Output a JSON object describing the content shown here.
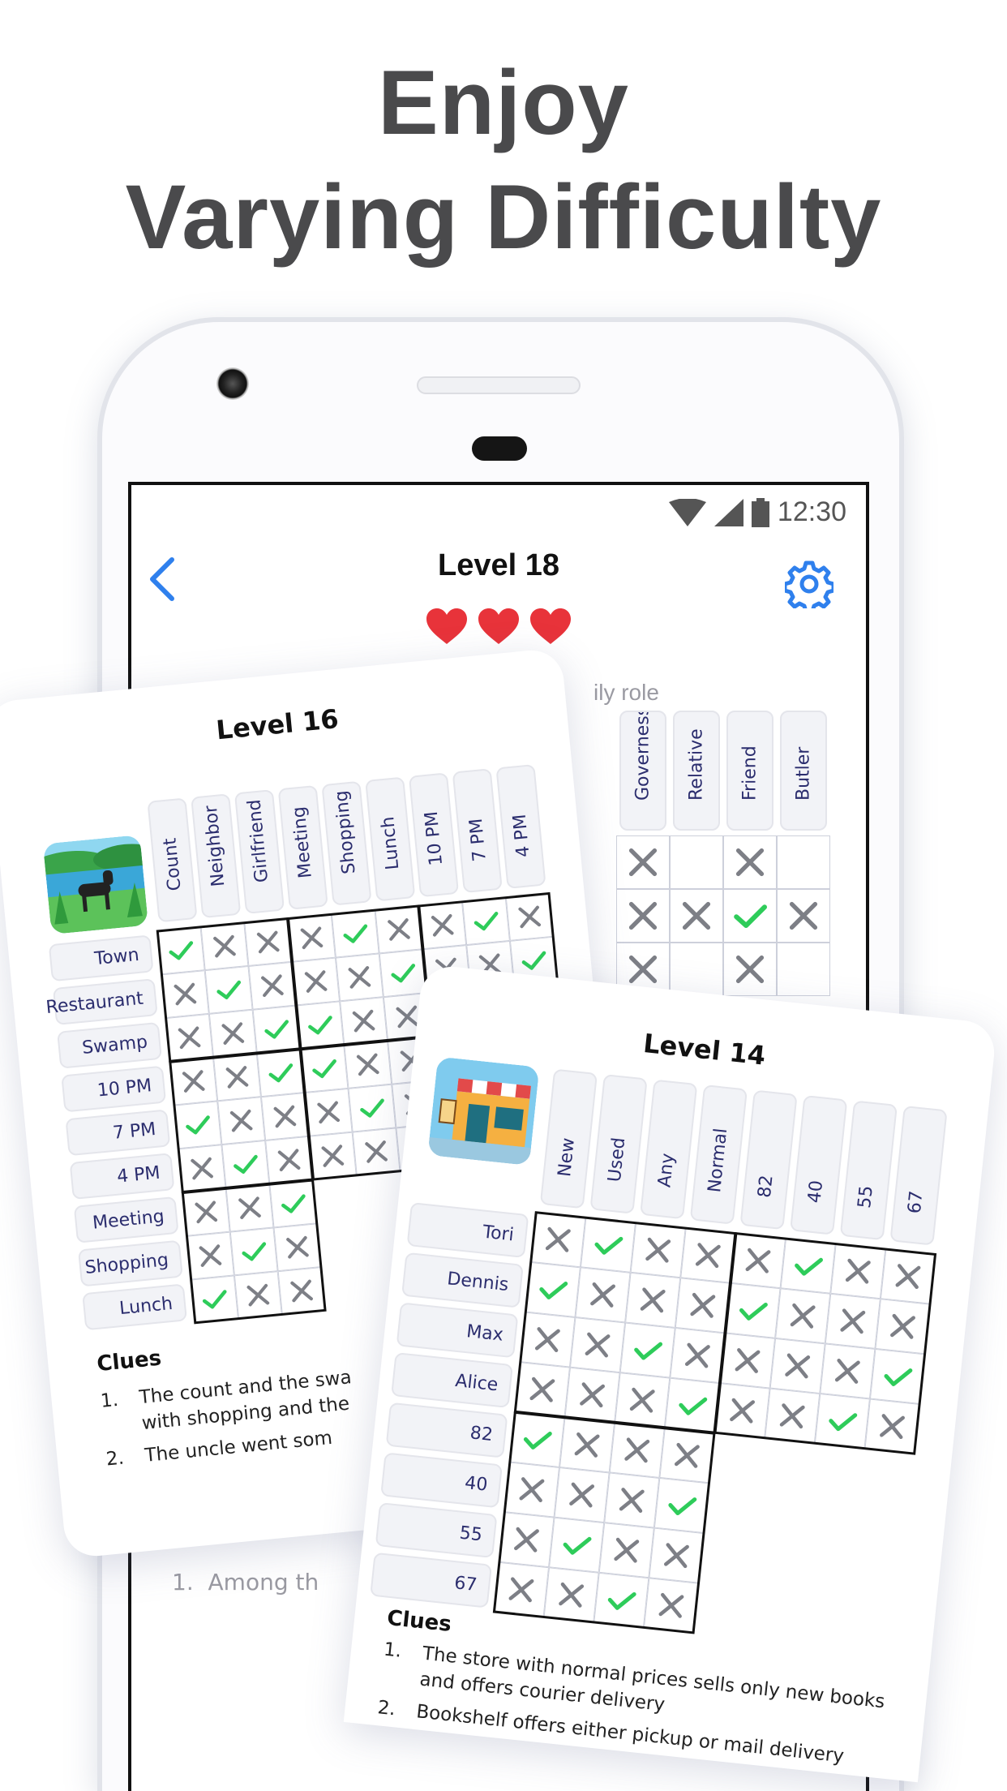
{
  "headline": {
    "line1": "Enjoy",
    "line2": "Varying Difficulty"
  },
  "colors": {
    "accent": "#2f80ed",
    "check": "#2ecc5a",
    "cross": "#7d7f86",
    "heart": "#e8333a",
    "label": "#2b2d6e"
  },
  "status_bar": {
    "time": "12:30",
    "icons": [
      "wifi-icon",
      "signal-icon",
      "battery-icon"
    ]
  },
  "background_screen": {
    "title": "Level 18",
    "lives": 3,
    "category_label": "ily role",
    "columns": [
      "Governess",
      "Relative",
      "Friend",
      "Butler"
    ],
    "rows": [
      [
        "cross",
        "",
        "cross",
        ""
      ],
      [
        "cross",
        "cross",
        "check",
        "cross"
      ],
      [
        "cross",
        "",
        "cross",
        ""
      ]
    ],
    "clue_fragment": {
      "num": "1.",
      "text": "Among th"
    }
  },
  "level16": {
    "title": "Level 16",
    "image": "dog-by-lake",
    "columns": [
      "Count",
      "Neighbor",
      "Girlfriend",
      "Meeting",
      "Shopping",
      "Lunch",
      "10 PM",
      "7 PM",
      "4 PM"
    ],
    "rows": [
      {
        "label": "Town",
        "marks": [
          "check",
          "cross",
          "cross",
          "cross",
          "check",
          "cross",
          "cross",
          "check",
          "cross"
        ]
      },
      {
        "label": "Restaurant",
        "marks": [
          "cross",
          "check",
          "cross",
          "cross",
          "cross",
          "check",
          "cross",
          "cross",
          "check"
        ]
      },
      {
        "label": "Swamp",
        "marks": [
          "cross",
          "cross",
          "check",
          "check",
          "cross",
          "cross",
          "check",
          "cross",
          "cross"
        ]
      },
      {
        "label": "10 PM",
        "marks": [
          "cross",
          "cross",
          "check",
          "check",
          "cross",
          "cross"
        ]
      },
      {
        "label": "7 PM",
        "marks": [
          "check",
          "cross",
          "cross",
          "cross",
          "check",
          "cross"
        ]
      },
      {
        "label": "4 PM",
        "marks": [
          "cross",
          "check",
          "cross",
          "cross",
          "cross",
          "check"
        ]
      },
      {
        "label": "Meeting",
        "marks": [
          "cross",
          "cross",
          "check"
        ]
      },
      {
        "label": "Shopping",
        "marks": [
          "cross",
          "check",
          "cross"
        ]
      },
      {
        "label": "Lunch",
        "marks": [
          "check",
          "cross",
          "cross"
        ]
      }
    ],
    "clues_heading": "Clues",
    "clues": [
      {
        "num": "1.",
        "lines": [
          "The count and the swa",
          "with shopping and the"
        ]
      },
      {
        "num": "2.",
        "lines": [
          "The uncle went som"
        ]
      }
    ]
  },
  "level14": {
    "title": "Level 14",
    "image": "bookstore-front",
    "columns": [
      "New",
      "Used",
      "Any",
      "Normal",
      "82",
      "40",
      "55",
      "67"
    ],
    "rows": [
      {
        "label": "Tori",
        "marks": [
          "cross",
          "check",
          "cross",
          "cross",
          "cross",
          "check",
          "cross",
          "cross"
        ]
      },
      {
        "label": "Dennis",
        "marks": [
          "check",
          "cross",
          "cross",
          "cross",
          "check",
          "cross",
          "cross",
          "cross"
        ]
      },
      {
        "label": "Max",
        "marks": [
          "cross",
          "cross",
          "check",
          "cross",
          "cross",
          "cross",
          "cross",
          "check"
        ]
      },
      {
        "label": "Alice",
        "marks": [
          "cross",
          "cross",
          "cross",
          "check",
          "cross",
          "cross",
          "check",
          "cross"
        ]
      },
      {
        "label": "82",
        "marks": [
          "check",
          "cross",
          "cross",
          "cross"
        ]
      },
      {
        "label": "40",
        "marks": [
          "cross",
          "cross",
          "cross",
          "check"
        ]
      },
      {
        "label": "55",
        "marks": [
          "cross",
          "check",
          "cross",
          "cross"
        ]
      },
      {
        "label": "67",
        "marks": [
          "cross",
          "cross",
          "check",
          "cross"
        ]
      }
    ],
    "clues_heading": "Clues",
    "clues": [
      {
        "num": "1.",
        "lines": [
          "The store with normal prices sells only new books",
          "and offers courier delivery"
        ]
      },
      {
        "num": "2.",
        "lines": [
          "Bookshelf offers either pickup or mail delivery"
        ]
      }
    ]
  }
}
